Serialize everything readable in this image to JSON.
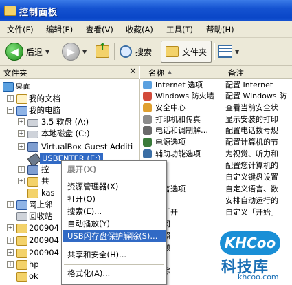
{
  "window": {
    "title": "控制面板"
  },
  "menu": [
    "文件(F)",
    "编辑(E)",
    "查看(V)",
    "收藏(A)",
    "工具(T)",
    "帮助(H)"
  ],
  "toolbar": {
    "back": "后退",
    "search": "搜索",
    "folders": "文件夹"
  },
  "left_header": "文件夹",
  "right_headers": {
    "name": "名称",
    "comment": "备注"
  },
  "tree": [
    {
      "label": "桌面",
      "icon": "desktop-icon"
    },
    {
      "label": "我的文档",
      "icon": "folder-icon"
    },
    {
      "label": "我的电脑",
      "icon": "computer-icon"
    },
    {
      "label": "3.5 软盘 (A:)",
      "icon": "floppy-icon"
    },
    {
      "label": "本地磁盘 (C:)",
      "icon": "drive-icon"
    },
    {
      "label": "VirtualBox Guest Additi",
      "icon": "cd-icon"
    },
    {
      "label": "USBENTER (E:)",
      "icon": "usb-icon"
    },
    {
      "label": "控",
      "icon": "control-panel-icon"
    },
    {
      "label": "共",
      "icon": "folder-icon"
    },
    {
      "label": "kas",
      "icon": "folder-icon"
    },
    {
      "label": "网上邻",
      "icon": "network-icon"
    },
    {
      "label": "回收站",
      "icon": "recycle-bin-icon"
    },
    {
      "label": "200904",
      "icon": "folder-icon"
    },
    {
      "label": "200904",
      "icon": "folder-icon"
    },
    {
      "label": "200904",
      "icon": "folder-icon"
    },
    {
      "label": "hp",
      "icon": "folder-icon"
    },
    {
      "label": "ok",
      "icon": "folder-icon"
    }
  ],
  "items": [
    {
      "name": "Internet 选项",
      "comment": "配置 Internet "
    },
    {
      "name": "Windows 防火墙",
      "comment": "配置 Windows 防"
    },
    {
      "name": "安全中心",
      "comment": "查看当前安全状"
    },
    {
      "name": "打印机和传真",
      "comment": "显示安装的打印"
    },
    {
      "name": "电话和调制解…",
      "comment": "配置电话拨号规"
    },
    {
      "name": "电源选项",
      "comment": "配置计算机的节"
    },
    {
      "name": "辅助功能选项",
      "comment": "为视觉、听力和"
    },
    {
      "name": "具",
      "comment": "配置您计算机的"
    },
    {
      "name": "",
      "comment": "自定义键盘设置"
    },
    {
      "name": "语言选项",
      "comment": "自定义语言、数"
    },
    {
      "name": "划",
      "comment": "安排自动运行的"
    },
    {
      "name": "和「开",
      "comment": "自定义「开始」"
    },
    {
      "name": "时间",
      "comment": ""
    },
    {
      "name": "和照",
      "comment": ""
    },
    {
      "name": "音频",
      "comment": ""
    },
    {
      "name": "",
      "comment": ""
    },
    {
      "name": "删除",
      "comment": ""
    }
  ],
  "context_menu": [
    "展开(X)",
    "资源管理器(X)",
    "打开(O)",
    "搜索(E)...",
    "自动播放(Y)",
    "USB闪存盘保护解除(S)...",
    "共享和安全(H)...",
    "格式化(A)..."
  ],
  "watermark": {
    "logo": "KHCoo",
    "name": "科技库",
    "url": "khcoo.com"
  }
}
